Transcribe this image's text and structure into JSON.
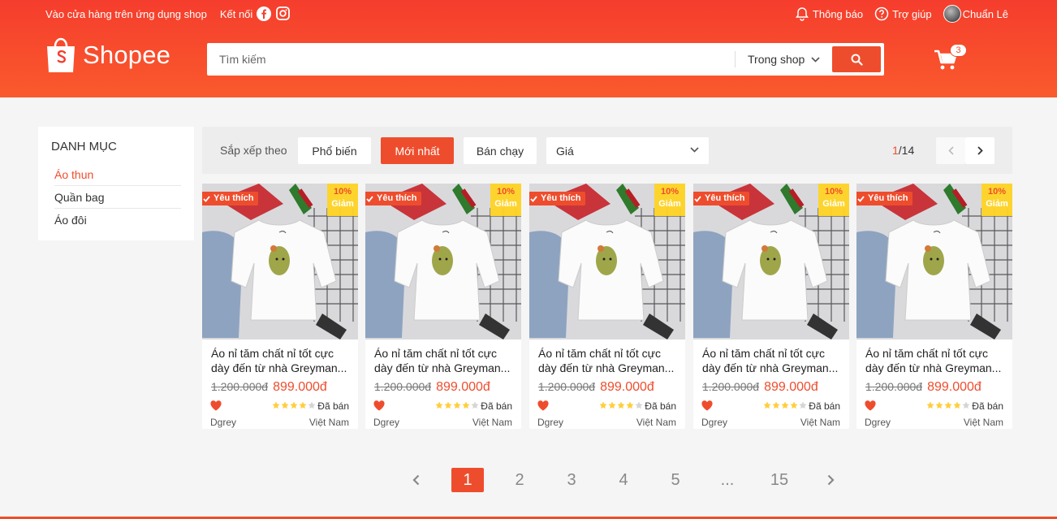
{
  "topbar": {
    "download_app": "Vào cửa hàng trên ứng dụng shop",
    "connect": "Kết nối",
    "notifications": "Thông báo",
    "help": "Trợ giúp",
    "username": "Chuẩn Lê"
  },
  "logo": {
    "text": "Shopee"
  },
  "search": {
    "placeholder": "Tìm kiếm",
    "scope": "Trong shop"
  },
  "cart": {
    "count": "3"
  },
  "sidebar": {
    "heading": "DANH MỤC",
    "categories": [
      "Áo thun",
      "Quần bag",
      "Áo đôi"
    ]
  },
  "sort": {
    "label": "Sắp xếp theo",
    "popular": "Phổ biến",
    "newest": "Mới nhất",
    "bestseller": "Bán chạy",
    "price": "Giá",
    "page_current": "1",
    "page_total": "/14"
  },
  "product": {
    "fav_label": "Yêu thích",
    "discount": "10%",
    "discount_word": "Giảm",
    "name": "Áo nỉ tăm chất nỉ tốt cực dày đến từ nhà Greyman...",
    "old_price": "1.200.000đ",
    "new_price": "899.000đ",
    "rating": 4,
    "sold": "Đã bán",
    "brand": "Dgrey",
    "origin": "Việt Nam"
  },
  "pagination": {
    "pages": [
      "1",
      "2",
      "3",
      "4",
      "5",
      "...",
      "15"
    ],
    "active": "1"
  },
  "colors": {
    "brand": "#ee4d2d",
    "header": "#f53d2d",
    "discount_bg": "#ffd424",
    "star": "#ffce3d"
  }
}
